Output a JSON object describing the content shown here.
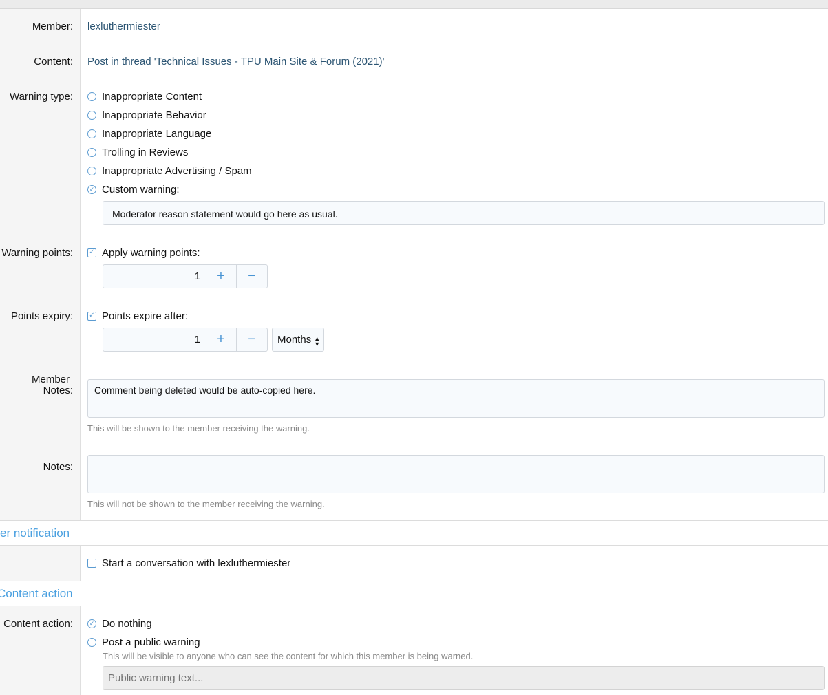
{
  "member": {
    "label": "Member:",
    "value": "lexluthermiester"
  },
  "content": {
    "label": "Content:",
    "value": "Post in thread 'Technical Issues - TPU Main Site & Forum (2021)'"
  },
  "warning_type": {
    "label": "Warning type:",
    "options": [
      {
        "label": "Inappropriate Content",
        "checked": false
      },
      {
        "label": "Inappropriate Behavior",
        "checked": false
      },
      {
        "label": "Inappropriate Language",
        "checked": false
      },
      {
        "label": "Trolling in Reviews",
        "checked": false
      },
      {
        "label": "Inappropriate Advertising / Spam",
        "checked": false
      },
      {
        "label": "Custom warning:",
        "checked": true
      }
    ],
    "custom_value": "Moderator reason statement would go here as usual."
  },
  "warning_points": {
    "label": "Warning points:",
    "checkbox_label": "Apply warning points:",
    "checked": true,
    "value": "1",
    "plus": "+",
    "minus": "−"
  },
  "points_expiry": {
    "label": "Points expiry:",
    "checkbox_label": "Points expire after:",
    "checked": true,
    "value": "1",
    "plus": "+",
    "minus": "−",
    "unit": "Months"
  },
  "member_notes": {
    "label_line1": "Member",
    "label_line2": "Notes:",
    "value": "Comment being deleted would be auto-copied here.",
    "hint": "This will be shown to the member receiving the warning."
  },
  "notes": {
    "label": "Notes:",
    "value": "",
    "hint": "This will not be shown to the member receiving the warning."
  },
  "notification_section": {
    "title": "er notification",
    "checkbox_label": "Start a conversation with lexluthermiester",
    "checked": false
  },
  "content_action_section": {
    "title": "Content action",
    "label": "Content action:",
    "options": [
      {
        "label": "Do nothing",
        "checked": true
      },
      {
        "label": "Post a public warning",
        "checked": false
      }
    ],
    "public_hint": "This will be visible to anyone who can see the content for which this member is being warned.",
    "public_placeholder": "Public warning text..."
  },
  "colors": {
    "accent": "#4aa0e0",
    "link": "#2c5573"
  }
}
